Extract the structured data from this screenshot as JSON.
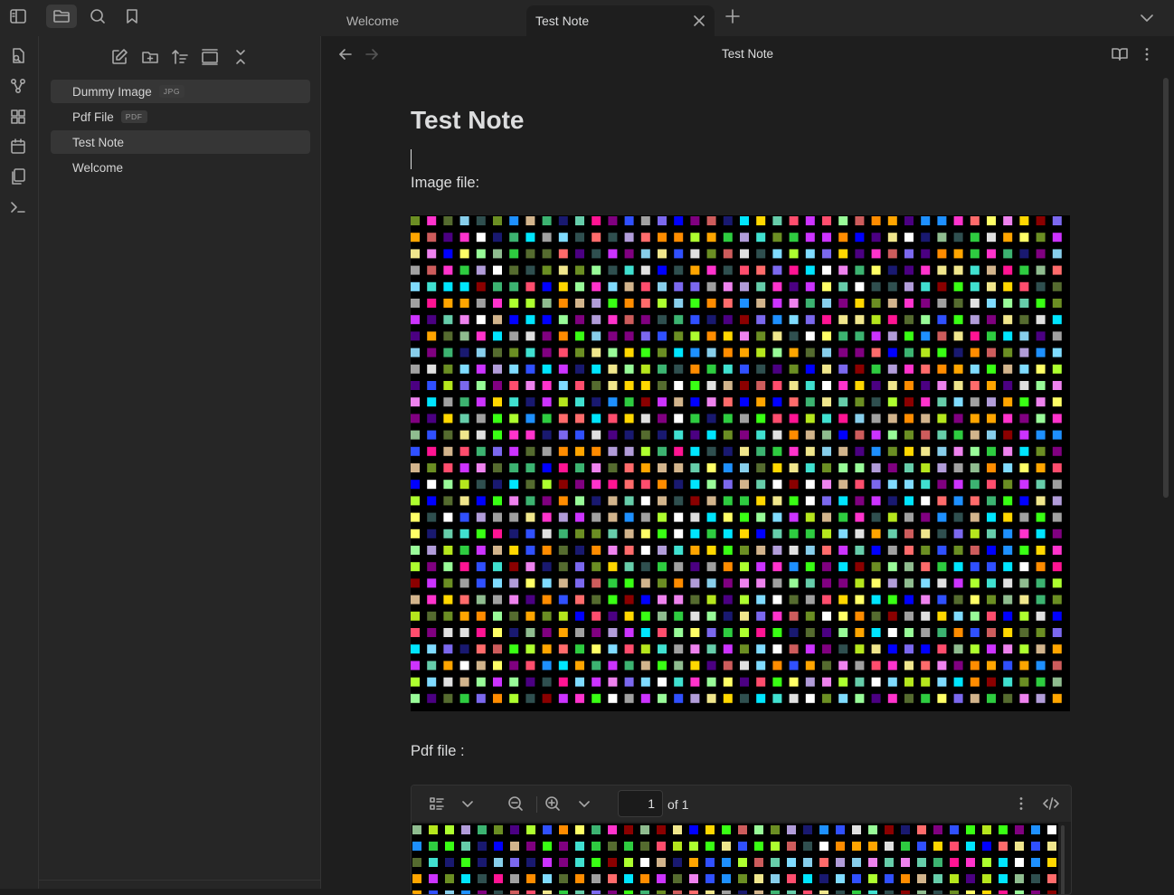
{
  "tabs": [
    {
      "label": "Welcome"
    },
    {
      "label": "Test Note"
    }
  ],
  "sidebar": {
    "files": [
      {
        "name": "Dummy Image",
        "badge": "JPG",
        "selected": true
      },
      {
        "name": "Pdf File",
        "badge": "PDF",
        "selected": false
      },
      {
        "name": "Test Note",
        "badge": "",
        "selected": true
      },
      {
        "name": "Welcome",
        "badge": "",
        "selected": false
      }
    ]
  },
  "view": {
    "header_title": "Test Note"
  },
  "note": {
    "title": "Test Note",
    "image_label": "Image file:",
    "pdf_label": "Pdf file :"
  },
  "pdf": {
    "page_value": "1",
    "page_of": "of 1"
  },
  "colors": {
    "background": "#1e1e1e",
    "sidebar": "#262626",
    "selected_item": "#363636",
    "text": "#dcddde",
    "muted": "#a8a8a8"
  },
  "icons": {
    "titlebar": [
      "sidebar-toggle-icon",
      "folder-icon",
      "search-icon",
      "bookmark-icon"
    ],
    "ribbon": [
      "switcher-icon",
      "graph-icon",
      "canvas-icon",
      "calendar-icon",
      "templates-icon",
      "terminal-icon"
    ],
    "explorer": [
      "new-note-icon",
      "new-folder-icon",
      "sort-icon",
      "collapse-icon",
      "close-icon"
    ]
  }
}
